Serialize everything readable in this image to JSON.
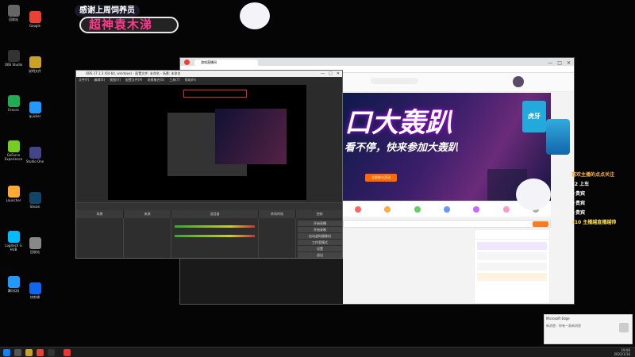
{
  "desktop_icons": [
    {
      "name": "icon-recycle-bin",
      "label": "回收站"
    },
    {
      "name": "icon-chrome",
      "label": "Google"
    },
    {
      "name": "icon-obs",
      "label": "OBS Studio"
    },
    {
      "name": "icon-folder",
      "label": "说明文件"
    },
    {
      "name": "icon-fence",
      "label": "Fences"
    },
    {
      "name": "icon-quicker",
      "label": "quicker"
    },
    {
      "name": "icon-geforce",
      "label": "GeForce Experience"
    },
    {
      "name": "icon-studio",
      "label": "Studio One"
    },
    {
      "name": "icon-launcher",
      "label": "Launcher"
    },
    {
      "name": "icon-steam",
      "label": "Steam"
    },
    {
      "name": "icon-logitech",
      "label": "Logitech G HUB"
    },
    {
      "name": "icon-trash",
      "label": "回收站"
    },
    {
      "name": "icon-qq",
      "label": "腾讯QQ"
    },
    {
      "name": "icon-k",
      "label": "快剪辑"
    }
  ],
  "overlay": {
    "line1": "感谢上周饲养员",
    "line2": "超神袁木涕"
  },
  "browser": {
    "tab_title": "游戏直播间",
    "banner_text": "口大轰趴",
    "banner_sub": "看不停，快来参加大轰趴",
    "banner_button": "立即参与活动",
    "side_card": "虎牙",
    "chat": [
      {
        "text": "喜欢主播的点点关注",
        "color": "#ffb347"
      },
      {
        "text": "x2 上车",
        "color": "#ffffff"
      },
      {
        "text": "+贵宾",
        "color": "#ffffff"
      },
      {
        "text": "+贵宾",
        "color": "#ffffff"
      },
      {
        "text": "+贵宾",
        "color": "#ffffff"
      },
      {
        "text": "x10 主播越直播越帅",
        "color": "#ffe14d"
      }
    ]
  },
  "obs": {
    "title": "OBS 27.1.3 (64-bit, windows) - 配置文件: 未命名 - 场景: 未命名",
    "menu": [
      "文件(F)",
      "编辑(E)",
      "视图(V)",
      "配置文件(P)",
      "场景集合(S)",
      "工具(T)",
      "帮助(H)"
    ],
    "docks": [
      "场景",
      "来源",
      "混音器",
      "转场特效",
      "控制"
    ],
    "controls": [
      "开始直播",
      "开始录制",
      "启动虚拟摄像机",
      "工作室模式",
      "设置",
      "退出"
    ],
    "status": "LIVE: 00:00:00  REC: 00:00:00  CPU: 1.8%, 60.00 fps"
  },
  "notification": {
    "title": "Microsoft Edge",
    "body": "新消息：你有一条新消息"
  },
  "taskbar": {
    "time": "19:06",
    "date": "2022/1/16"
  }
}
